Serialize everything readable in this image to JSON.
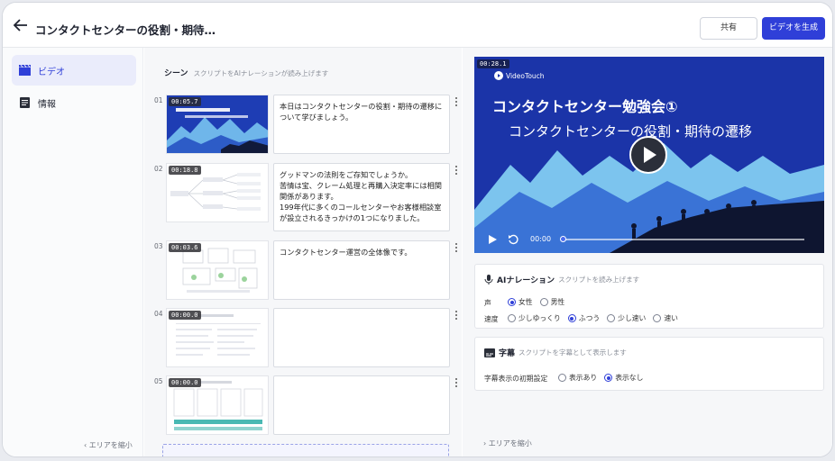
{
  "header": {
    "title": "コンタクトセンターの役割・期待…",
    "share_label": "共有",
    "generate_label": "ビデオを生成"
  },
  "sidebar": {
    "items": [
      {
        "label": "ビデオ",
        "icon": "clapperboard-icon",
        "active": true
      },
      {
        "label": "情報",
        "icon": "document-icon",
        "active": false
      }
    ],
    "collapse_label": "エリアを縮小"
  },
  "scenes": {
    "title": "シーン",
    "subtitle": "スクリプトをAIナレーションが読み上げます",
    "items": [
      {
        "num": "01",
        "duration": "00:05.7",
        "text": "本日はコンタクトセンターの役割・期待の遷移について学びましょう。"
      },
      {
        "num": "02",
        "duration": "00:18.8",
        "text": "グッドマンの法則をご存知でしょうか。\n苦情は宝、クレーム処理と再購入決定率には相関関係があります。\n199年代に多くのコールセンターやお客様相談室が設立されるきっかけの1つになりました。"
      },
      {
        "num": "03",
        "duration": "00:03.6",
        "text": "コンタクトセンター運営の全体像です。"
      },
      {
        "num": "04",
        "duration": "00:00.0",
        "text": ""
      },
      {
        "num": "05",
        "duration": "00:00.0",
        "text": ""
      }
    ]
  },
  "video": {
    "time_badge": "00:28.1",
    "logo": "VideoTouch",
    "title": "コンタクトセンター勉強会①",
    "subtitle": "コンタクトセンターの役割・期待の遷移",
    "current_time": "00:00"
  },
  "narration": {
    "title": "AIナレーション",
    "subtitle": "スクリプトを読み上げます",
    "voice_label": "声",
    "voice_options": [
      "女性",
      "男性"
    ],
    "voice_selected": "女性",
    "speed_label": "速度",
    "speed_options": [
      "少しゆっくり",
      "ふつう",
      "少し速い",
      "速い"
    ],
    "speed_selected": "ふつう"
  },
  "captions": {
    "title": "字幕",
    "subtitle": "スクリプトを字幕として表示します",
    "default_label": "字幕表示の初期設定",
    "options": [
      "表示あり",
      "表示なし"
    ],
    "selected": "表示なし"
  },
  "right_collapse_label": "エリアを縮小",
  "colors": {
    "accent": "#2f3fd8",
    "video_bg": "#1b34a8"
  }
}
